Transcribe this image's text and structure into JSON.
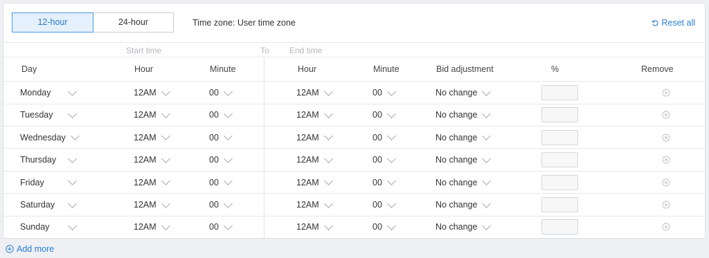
{
  "toggle": {
    "option_12": "12-hour",
    "option_24": "24-hour",
    "selected": "12-hour"
  },
  "timezone_label": "Time zone: User time zone",
  "reset_label": "Reset all",
  "groups": {
    "start": "Start time",
    "to": "To",
    "end": "End time"
  },
  "headers": {
    "day": "Day",
    "start_hour": "Hour",
    "start_minute": "Minute",
    "end_hour": "Hour",
    "end_minute": "Minute",
    "bid": "Bid adjustment",
    "pct": "%",
    "remove": "Remove"
  },
  "rows": [
    {
      "day": "Monday",
      "start_hour": "12AM",
      "start_minute": "00",
      "end_hour": "12AM",
      "end_minute": "00",
      "bid": "No change",
      "pct": ""
    },
    {
      "day": "Tuesday",
      "start_hour": "12AM",
      "start_minute": "00",
      "end_hour": "12AM",
      "end_minute": "00",
      "bid": "No change",
      "pct": ""
    },
    {
      "day": "Wednesday",
      "start_hour": "12AM",
      "start_minute": "00",
      "end_hour": "12AM",
      "end_minute": "00",
      "bid": "No change",
      "pct": ""
    },
    {
      "day": "Thursday",
      "start_hour": "12AM",
      "start_minute": "00",
      "end_hour": "12AM",
      "end_minute": "00",
      "bid": "No change",
      "pct": ""
    },
    {
      "day": "Friday",
      "start_hour": "12AM",
      "start_minute": "00",
      "end_hour": "12AM",
      "end_minute": "00",
      "bid": "No change",
      "pct": ""
    },
    {
      "day": "Saturday",
      "start_hour": "12AM",
      "start_minute": "00",
      "end_hour": "12AM",
      "end_minute": "00",
      "bid": "No change",
      "pct": ""
    },
    {
      "day": "Sunday",
      "start_hour": "12AM",
      "start_minute": "00",
      "end_hour": "12AM",
      "end_minute": "00",
      "bid": "No change",
      "pct": ""
    }
  ],
  "add_more_label": "Add more",
  "colors": {
    "accent": "#2a7fd4",
    "active_bg": "#e4f0fb",
    "border": "#dcdfe3"
  },
  "icons": {
    "reset": "refresh-icon",
    "remove": "close-circle-icon",
    "add": "plus-circle-icon",
    "dropdown": "chevron-down-icon"
  }
}
